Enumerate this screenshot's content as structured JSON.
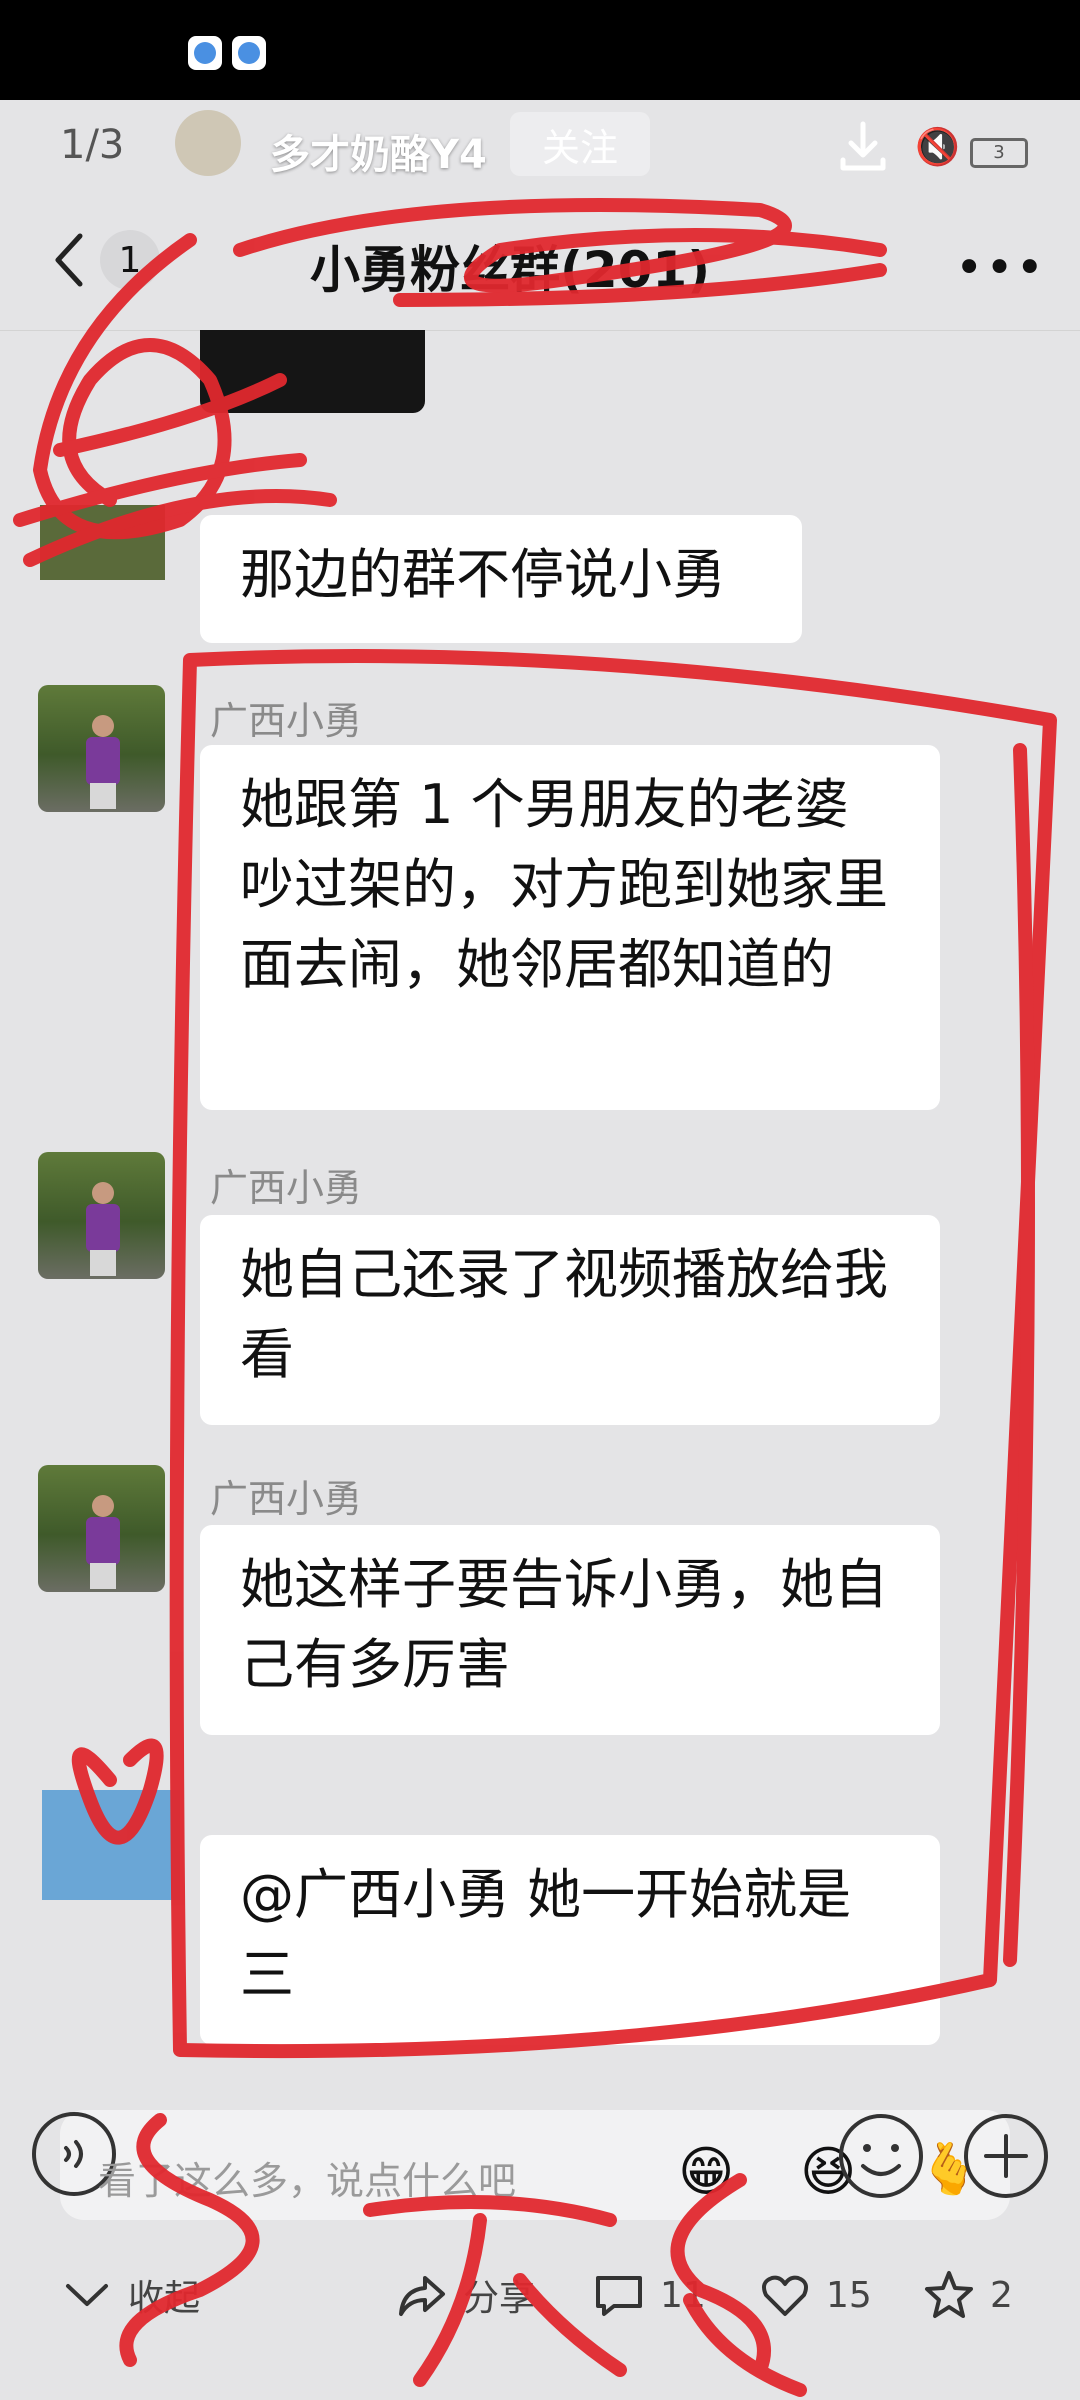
{
  "viewer": {
    "page_indicator": "1/3",
    "author_name": "多才奶酪Y4",
    "follow_label": "关注",
    "battery": "3"
  },
  "chat": {
    "back_count": "1",
    "title": "小勇粉丝群(201)",
    "messages": [
      {
        "sender": "",
        "text": "那边的群不停说小勇"
      },
      {
        "sender": "广西小勇",
        "text": "她跟第 1 个男朋友的老婆吵过架的，对方跑到她家里面去闹，她邻居都知道的"
      },
      {
        "sender": "广西小勇",
        "text": "她自己还录了视频播放给我看"
      },
      {
        "sender": "广西小勇",
        "text": "她这样子要告诉小勇，她自己有多厉害"
      },
      {
        "sender": "",
        "text": "@广西小勇  她一开始就是三"
      }
    ]
  },
  "comment_bar": {
    "placeholder": "看了这么多，说点什么吧",
    "emojis": [
      "😁",
      "😆",
      "🫰"
    ]
  },
  "bottom_bar": {
    "collapse_label": "收起",
    "share_label": "分享",
    "comments_count": "11",
    "likes_count": "15",
    "favorites_count": "2"
  },
  "colors": {
    "doodle_red": "#e0282e",
    "bubble_bg": "#ffffff",
    "chat_bg": "#e4e4e6"
  }
}
